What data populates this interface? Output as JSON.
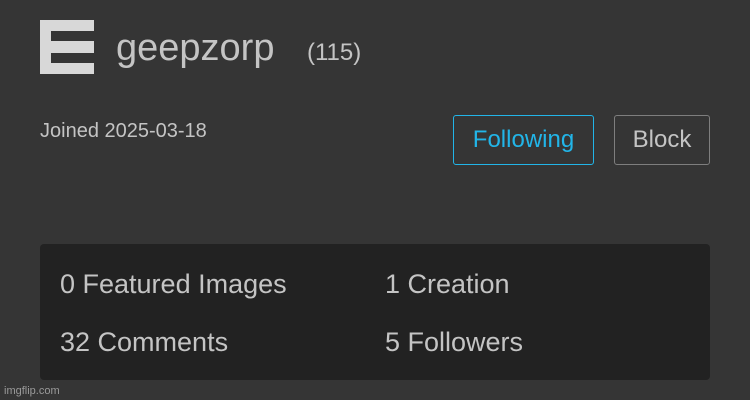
{
  "profile": {
    "username": "geepzorp",
    "points": "(115)",
    "joined": "Joined 2025-03-18",
    "avatar_icon": "letter-block-icon"
  },
  "actions": {
    "following_label": "Following",
    "block_label": "Block"
  },
  "stats": {
    "featured_images": "0 Featured Images",
    "creations": "1 Creation",
    "comments": "32 Comments",
    "followers": "5 Followers"
  },
  "watermark": "imgflip.com",
  "colors": {
    "background": "#353535",
    "panel": "#222222",
    "text": "#c4c4c4",
    "accent": "#22b5e8"
  }
}
